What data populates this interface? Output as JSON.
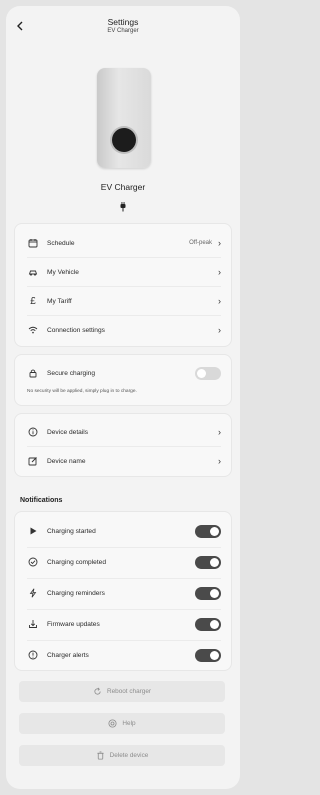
{
  "header": {
    "title": "Settings",
    "subtitle": "EV Charger",
    "back_icon": "chevron-left-icon"
  },
  "device": {
    "name": "EV Charger",
    "status_icon": "plug-icon"
  },
  "menu": [
    {
      "label": "Schedule",
      "value": "Off-peak",
      "icon": "calendar-icon"
    },
    {
      "label": "My Vehicle",
      "value": "",
      "icon": "car-icon"
    },
    {
      "label": "My Tariff",
      "value": "",
      "icon": "pound-icon"
    },
    {
      "label": "Connection settings",
      "value": "",
      "icon": "wifi-icon"
    }
  ],
  "security": {
    "label": "Secure charging",
    "enabled": false,
    "note": "No security will be applied, simply plug in to charge."
  },
  "device_menu": [
    {
      "label": "Device details",
      "icon": "info-icon"
    },
    {
      "label": "Device name",
      "icon": "edit-icon"
    }
  ],
  "notifications": {
    "title": "Notifications",
    "items": [
      {
        "label": "Charging started",
        "enabled": true,
        "icon": "play-icon"
      },
      {
        "label": "Charging completed",
        "enabled": true,
        "icon": "check-circle-icon"
      },
      {
        "label": "Charging reminders",
        "enabled": true,
        "icon": "bolt-icon"
      },
      {
        "label": "Firmware updates",
        "enabled": true,
        "icon": "download-icon"
      },
      {
        "label": "Charger alerts",
        "enabled": true,
        "icon": "alert-circle-icon"
      }
    ]
  },
  "actions": [
    {
      "label": "Reboot charger",
      "icon": "refresh-icon"
    },
    {
      "label": "Help",
      "icon": "help-icon"
    },
    {
      "label": "Delete device",
      "icon": "trash-icon"
    }
  ],
  "colors": {
    "background": "#e4e4e4",
    "screen": "#f3f3f3",
    "toggle_on": "#4a4a4a",
    "toggle_off": "#d9d9d9"
  }
}
